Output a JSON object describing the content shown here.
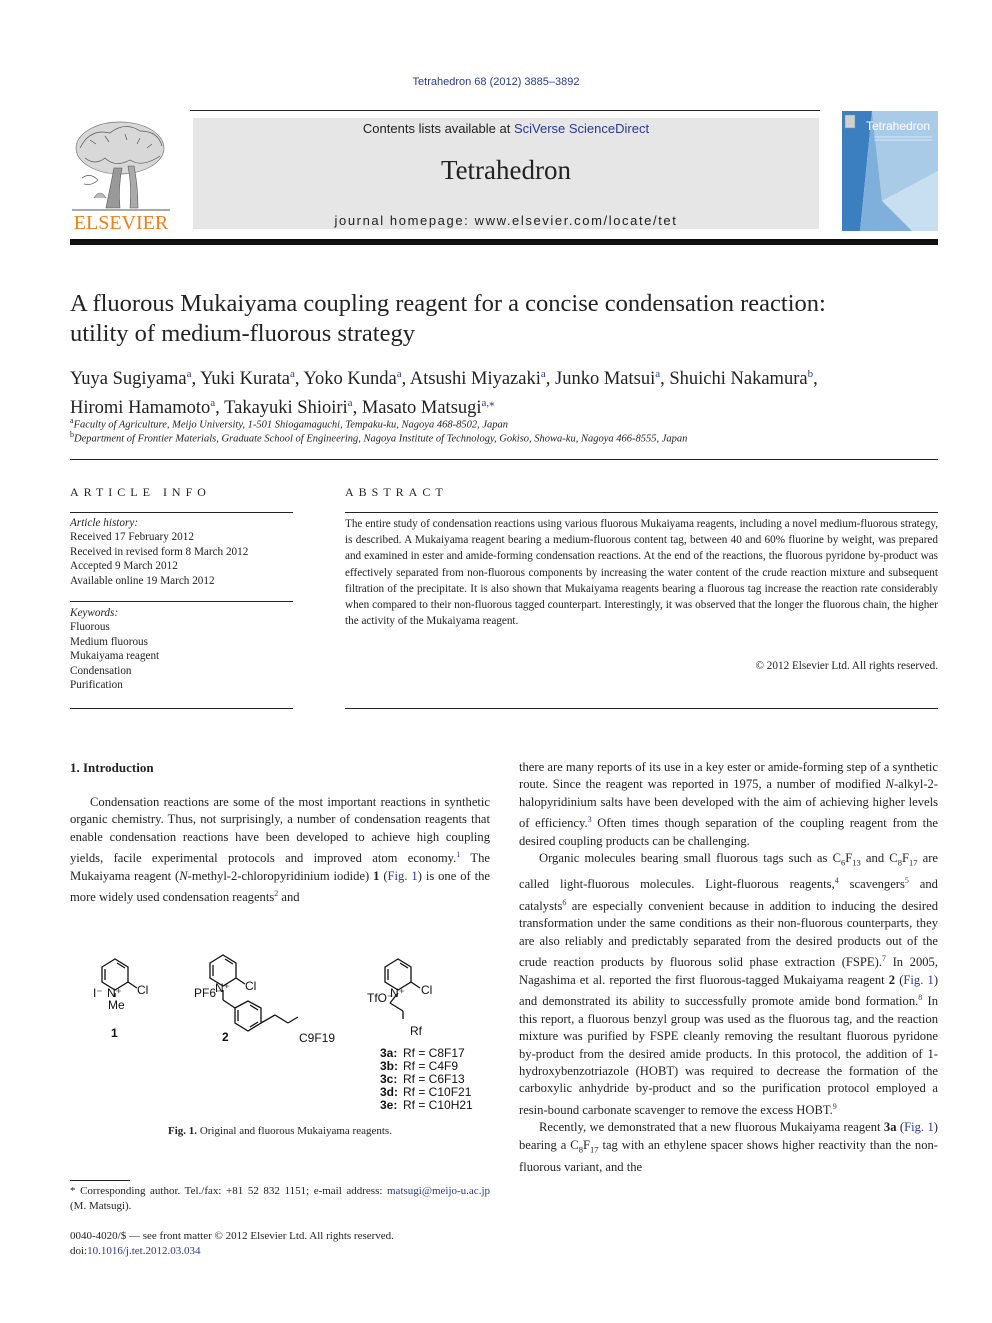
{
  "header": {
    "citation": "Tetrahedron 68 (2012) 3885–3892",
    "contents_prefix": "Contents lists available at ",
    "contents_link": "SciVerse ScienceDirect",
    "journal_name": "Tetrahedron",
    "homepage": "journal homepage: www.elsevier.com/locate/tet",
    "publisher_logo_text": "ELSEVIER",
    "cover_title": "Tetrahedron",
    "colors": {
      "elsevier_orange": "#f07f1b",
      "link_blue": "#2a3a8c",
      "masthead_gray": "#e6e6e6",
      "cover_blue": "#3b7fc0"
    }
  },
  "article": {
    "title_line1": "A fluorous Mukaiyama coupling reagent for a concise condensation reaction:",
    "title_line2": "utility of medium-fluorous strategy",
    "authors": [
      {
        "name": "Yuya Sugiyama",
        "aff": "a"
      },
      {
        "name": "Yuki Kurata",
        "aff": "a"
      },
      {
        "name": "Yoko Kunda",
        "aff": "a"
      },
      {
        "name": "Atsushi Miyazaki",
        "aff": "a"
      },
      {
        "name": "Junko Matsui",
        "aff": "a"
      },
      {
        "name": "Shuichi Nakamura",
        "aff": "b"
      },
      {
        "name": "Hiromi Hamamoto",
        "aff": "a"
      },
      {
        "name": "Takayuki Shioiri",
        "aff": "a"
      },
      {
        "name": "Masato Matsugi",
        "aff": "a,⁎"
      }
    ],
    "affiliations": [
      {
        "mark": "a",
        "text": "Faculty of Agriculture, Meijo University, 1-501 Shiogamaguchi, Tempaku-ku, Nagoya 468-8502, Japan"
      },
      {
        "mark": "b",
        "text": "Department of Frontier Materials, Graduate School of Engineering, Nagoya Institute of Technology, Gokiso, Showa-ku, Nagoya 466-8555, Japan"
      }
    ]
  },
  "article_info": {
    "heading": "ARTICLE INFO",
    "history_label": "Article history:",
    "history": [
      "Received 17 February 2012",
      "Received in revised form 8 March 2012",
      "Accepted 9 March 2012",
      "Available online 19 March 2012"
    ],
    "keywords_label": "Keywords:",
    "keywords": [
      "Fluorous",
      "Medium fluorous",
      "Mukaiyama reagent",
      "Condensation",
      "Purification"
    ]
  },
  "abstract": {
    "heading": "ABSTRACT",
    "text": "The entire study of condensation reactions using various fluorous Mukaiyama reagents, including a novel medium-fluorous strategy, is described. A Mukaiyama reagent bearing a medium-fluorous content tag, between 40 and 60% fluorine by weight, was prepared and examined in ester and amide-forming condensation reactions. At the end of the reactions, the fluorous pyridone by-product was effectively separated from non-fluorous components by increasing the water content of the crude reaction mixture and subsequent filtration of the precipitate. It is also shown that Mukaiyama reagents bearing a fluorous tag increase the reaction rate considerably when compared to their non-fluorous tagged counterpart. Interestingly, it was observed that the longer the fluorous chain, the higher the activity of the Mukaiyama reagent.",
    "copyright": "© 2012 Elsevier Ltd. All rights reserved."
  },
  "intro": {
    "heading": "1.  Introduction",
    "left_p1_a": "Condensation reactions are some of the most important reactions in synthetic organic chemistry. Thus, not surprisingly, a number of condensation reagents that enable condensation reactions have been developed to achieve high coupling yields, facile experimental protocols and improved atom economy.",
    "ref1": "1",
    "left_p1_b": " The Mukaiyama reagent (",
    "n_italic": "N",
    "left_p1_c": "-methyl-2-chloropyridinium iodide) ",
    "cmpd1": "1",
    "fig_ref": "Fig. 1",
    "left_p1_d": " is one of the more widely used condensation reagents",
    "ref2": "2",
    "left_p1_e": " and",
    "right_p1_a": "there are many reports of its use in a key ester or amide-forming step of a synthetic route. Since the reagent was reported in 1975, a number of modified ",
    "right_p1_b": "-alkyl-2-halopyridinium salts have been developed with the aim of achieving higher levels of efficiency.",
    "ref3": "3",
    "right_p1_c": " Often times though separation of the coupling reagent from the desired coupling products can be challenging.",
    "right_p2_a": "Organic molecules bearing small fluorous tags such as C",
    "right_p2_b": " and C",
    "right_p2_c": " are called light-fluorous molecules. Light-fluorous reagents,",
    "ref4": "4",
    "right_p2_d": " scavengers",
    "ref5": "5",
    "right_p2_e": " and catalysts",
    "ref6": "6",
    "right_p2_f": " are especially convenient because in addition to inducing the desired transformation under the same conditions as their non-fluorous counterparts, they are also reliably and predictably separated from the desired products out of the crude reaction products by fluorous solid phase extraction (FSPE).",
    "ref7": "7",
    "right_p2_g": " In 2005, Nagashima et al. reported the first fluorous-tagged Mukaiyama reagent ",
    "cmpd2": "2",
    "right_p2_h": " and demonstrated its ability to successfully promote amide bond formation.",
    "ref8": "8",
    "right_p2_i": " In this report, a fluorous benzyl group was used as the fluorous tag, and the reaction mixture was purified by FSPE cleanly removing the resultant fluorous pyridone by-product from the desired amide products. In this protocol, the addition of 1-hydroxybenzotriazole (HOBT) was required to decrease the formation of the carboxylic anhydride by-product and so the purification protocol employed a resin-bound carbonate scavenger to remove the excess HOBT.",
    "ref9": "9",
    "right_p3_a": "Recently, we demonstrated that a new fluorous Mukaiyama reagent ",
    "cmpd3a": "3a",
    "right_p3_b": " bearing a C",
    "right_p3_c": " tag with an ethylene spacer shows higher reactivity than the non-fluorous variant, and the",
    "sub6": "6",
    "sub13": "13",
    "sub8": "8",
    "sub17": "17"
  },
  "figure1": {
    "caption_label": "Fig. 1.",
    "caption_text": " Original and fluorous Mukaiyama reagents.",
    "compound_labels": [
      "1",
      "2"
    ],
    "cmpd1": {
      "counterion": "I⁻",
      "n_plus": "N⁺",
      "cl": "Cl",
      "me": "Me"
    },
    "cmpd2": {
      "counterion": "PF6⁻",
      "n_plus": "N⁺",
      "cl": "Cl",
      "tail": "C9F19"
    },
    "cmpd3": {
      "counterion": "TfO⁻",
      "n_plus": "N⁺",
      "cl": "Cl",
      "rf": "Rf"
    },
    "legend": [
      {
        "id": "3a:",
        "rf": "Rf = C8F17"
      },
      {
        "id": "3b:",
        "rf": "Rf = C4F9"
      },
      {
        "id": "3c:",
        "rf": "Rf = C6F13"
      },
      {
        "id": "3d:",
        "rf": "Rf = C10F21"
      },
      {
        "id": "3e:",
        "rf": "Rf = C10H21"
      }
    ]
  },
  "footer": {
    "corresponding": " * Corresponding author. Tel./fax: +81 52 832 1151; e-mail address: ",
    "email": "matsugi@meijo-u.ac.jp",
    "corresponding_end": " (M. Matsugi).",
    "frontmatter": "0040-4020/$ — see front matter © 2012 Elsevier Ltd. All rights reserved.",
    "doi_label": "doi:",
    "doi": "10.1016/j.tet.2012.03.034"
  }
}
